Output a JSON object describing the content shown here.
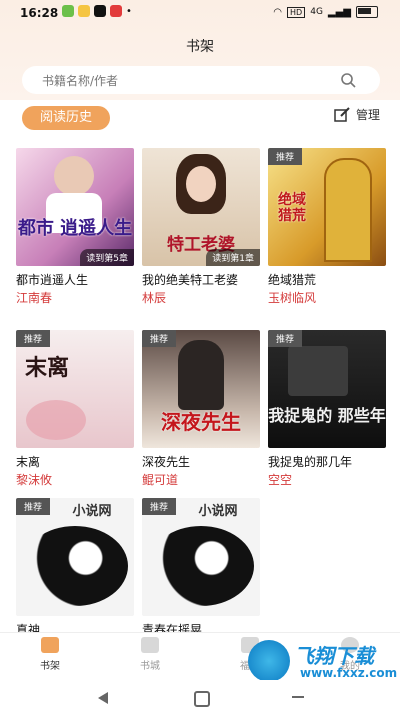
{
  "status": {
    "time": "16:28",
    "network": "HD",
    "signal": "4G"
  },
  "header": {
    "title": "书架"
  },
  "search": {
    "placeholder": "书籍名称/作者"
  },
  "history_label": "阅读历史",
  "manage_label": "管理",
  "books": [
    {
      "title": "都市逍遥人生",
      "author": "江南春",
      "badge": "",
      "progress": "读到第5章",
      "cover_text": "都市 逍遥人生"
    },
    {
      "title": "我的绝美特工老婆",
      "author": "林辰",
      "badge": "",
      "progress": "读到第1章",
      "cover_text": "特工老婆"
    },
    {
      "title": "绝域猎荒",
      "author": "玉树临风",
      "badge": "推荐",
      "progress": "",
      "cover_text": "绝域猎荒"
    },
    {
      "title": "末离",
      "author": "黎沫攸",
      "badge": "推荐",
      "progress": "",
      "cover_text": "末离"
    },
    {
      "title": "深夜先生",
      "author": "鲲可道",
      "badge": "推荐",
      "progress": "",
      "cover_text": "深夜先生"
    },
    {
      "title": "我捉鬼的那几年",
      "author": "空空",
      "badge": "推荐",
      "progress": "",
      "cover_text": "我捉鬼的 那些年"
    },
    {
      "title": "真神",
      "author": "",
      "badge": "推荐",
      "progress": "",
      "cover_text": "小说网"
    },
    {
      "title": "青春在摇晃",
      "author": "",
      "badge": "推荐",
      "progress": "",
      "cover_text": "小说网"
    }
  ],
  "tabs": [
    {
      "label": "书架",
      "active": true
    },
    {
      "label": "书城",
      "active": false
    },
    {
      "label": "福利",
      "active": false
    },
    {
      "label": "我的",
      "active": false
    }
  ],
  "watermark": {
    "title": "飞翔下载",
    "url": "www.fxxz.com"
  },
  "colors": {
    "accent": "#f0a35c",
    "author": "#d43b3b"
  }
}
